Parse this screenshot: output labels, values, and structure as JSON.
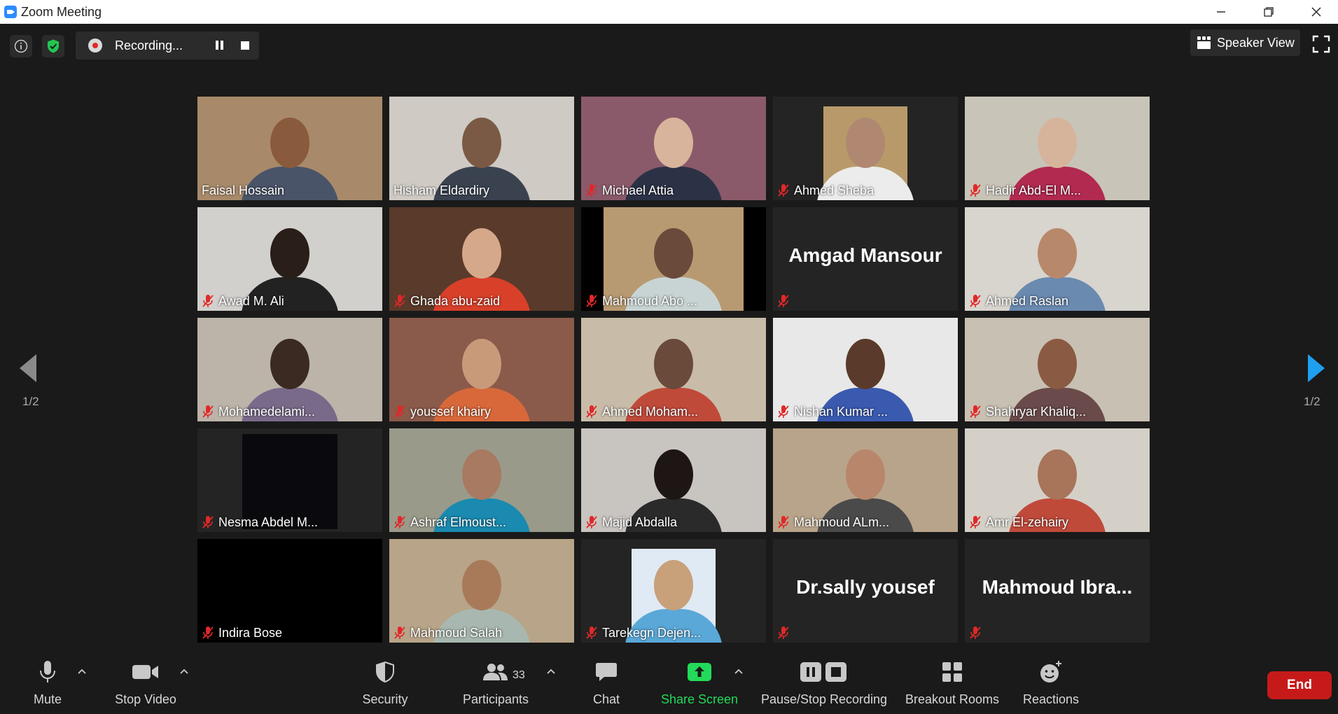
{
  "window": {
    "title": "Zoom Meeting"
  },
  "recording": {
    "label": "Recording..."
  },
  "view": {
    "label": "Speaker View"
  },
  "pager": {
    "prev_page": "1/2",
    "next_page": "1/2"
  },
  "participants": [
    {
      "name": "Faisal Hossain",
      "muted": false,
      "video": true,
      "bg": "#a88a6a",
      "face": "#8a5a3c",
      "shirt": "#4a5468"
    },
    {
      "name": "Hisham Eldardiry",
      "muted": false,
      "video": true,
      "active": true,
      "bg": "#cfcac4",
      "face": "#7a5a45",
      "shirt": "#3a4250"
    },
    {
      "name": "Michael Attia",
      "muted": true,
      "video": true,
      "bg": "#8a5a6a",
      "face": "#d8b49c",
      "shirt": "#2c3246"
    },
    {
      "name": "Ahmed Sheba",
      "muted": true,
      "video": true,
      "bg": "#2a2a2a",
      "face": "#b08770",
      "shirt": "#ececec",
      "framed": true
    },
    {
      "name": "Hadir Abd-El M...",
      "muted": true,
      "video": true,
      "bg": "#c8c4b8",
      "face": "#d6b49c",
      "shirt": "#b22a50"
    },
    {
      "name": "Awad M. Ali",
      "muted": true,
      "video": true,
      "bg": "#d2d0cc",
      "face": "#2a1e18",
      "shirt": "#222222"
    },
    {
      "name": "Ghada abu-zaid",
      "muted": true,
      "video": true,
      "bg": "#5a3a2a",
      "face": "#d6a88a",
      "shirt": "#d8402a"
    },
    {
      "name": "Mahmoud Abo ...",
      "muted": true,
      "video": true,
      "bg": "#b89a72",
      "face": "#6a4a3a",
      "shirt": "#c8d4d4",
      "letterbox": true
    },
    {
      "name": "",
      "display_name": "Amgad Mansour",
      "muted": true,
      "video": false
    },
    {
      "name": "Ahmed Raslan",
      "muted": true,
      "video": true,
      "bg": "#d8d4ce",
      "face": "#b8886a",
      "shirt": "#6a8ab0"
    },
    {
      "name": "Mohamedelami...",
      "muted": true,
      "video": true,
      "bg": "#bcb4a8",
      "face": "#3a2a22",
      "shirt": "#7a6a8a"
    },
    {
      "name": "youssef khairy",
      "muted": true,
      "video": true,
      "bg": "#8a5a4a",
      "face": "#c89a7a",
      "shirt": "#d8683a"
    },
    {
      "name": "Ahmed Moham...",
      "muted": true,
      "video": true,
      "bg": "#c8bca8",
      "face": "#6a4a3a",
      "shirt": "#c04a3a"
    },
    {
      "name": "Nishan Kumar ...",
      "muted": true,
      "video": true,
      "bg": "#e8e8e8",
      "face": "#5a3a2a",
      "shirt": "#3a5ab0"
    },
    {
      "name": "Shahryar Khaliq...",
      "muted": true,
      "video": true,
      "bg": "#c8c0b2",
      "face": "#8a5a42",
      "shirt": "#6a4a4a"
    },
    {
      "name": "Nesma Abdel M...",
      "muted": true,
      "video": true,
      "bg": "#242424",
      "face": "",
      "shirt": "",
      "blackbox": true
    },
    {
      "name": "Ashraf Elmoust...",
      "muted": true,
      "video": true,
      "bg": "#9a9a8a",
      "face": "#a87a62",
      "shirt": "#1a8ab0"
    },
    {
      "name": "Majid Abdalla",
      "muted": true,
      "video": true,
      "bg": "#c8c4c0",
      "face": "#1e1614",
      "shirt": "#2a2a2a"
    },
    {
      "name": "Mahmoud ALm...",
      "muted": true,
      "video": true,
      "bg": "#b8a48a",
      "face": "#b8866a",
      "shirt": "#4a4a4a"
    },
    {
      "name": "Amr El-zehairy",
      "muted": true,
      "video": true,
      "bg": "#d4d0c8",
      "face": "#a8745a",
      "shirt": "#c04a3a"
    },
    {
      "name": "Indira Bose",
      "muted": true,
      "video": true,
      "bg": "#000000",
      "face": "",
      "shirt": "",
      "dark": true
    },
    {
      "name": "Mahmoud Salah",
      "muted": true,
      "video": true,
      "bg": "#b8a488",
      "face": "#a87a5a",
      "shirt": "#a8b8b0"
    },
    {
      "name": "Tarekegn Dejen...",
      "muted": true,
      "video": true,
      "bg": "#242424",
      "face": "#c8a07a",
      "shirt": "#5aa8d8",
      "book": true
    },
    {
      "name": "",
      "display_name": "Dr.sally yousef",
      "muted": true,
      "video": false
    },
    {
      "name": "",
      "display_name": "Mahmoud  Ibra...",
      "muted": true,
      "video": false
    }
  ],
  "toolbar": {
    "mute": "Mute",
    "stop_video": "Stop Video",
    "security": "Security",
    "participants": "Participants",
    "participant_count": "33",
    "chat": "Chat",
    "share_screen": "Share Screen",
    "pause_stop_recording": "Pause/Stop Recording",
    "breakout_rooms": "Breakout Rooms",
    "reactions": "Reactions",
    "end": "End"
  },
  "colors": {
    "share_green": "#23d959",
    "end_red": "#c61a1a",
    "active_border": "#c5e34a",
    "nav_blue": "#1f9ff0"
  }
}
